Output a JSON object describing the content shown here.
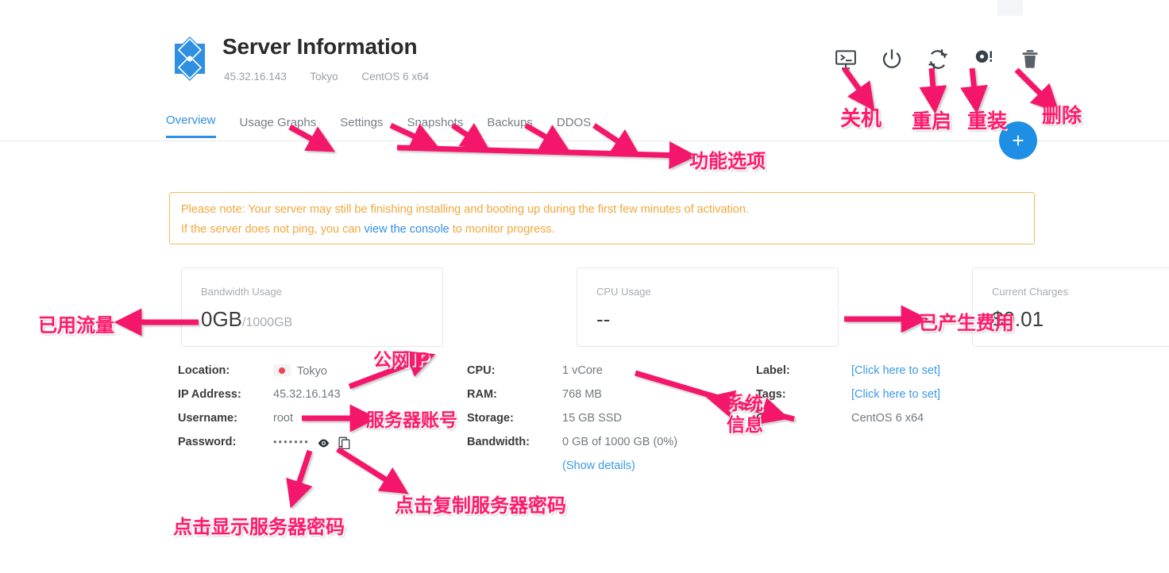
{
  "header": {
    "logo_icon": "vultr-diamond-logo",
    "title": "Server Information",
    "ip": "45.32.16.143",
    "location": "Tokyo",
    "os": "CentOS 6 x64"
  },
  "tabs": [
    {
      "label": "Overview",
      "active": true
    },
    {
      "label": "Usage Graphs",
      "active": false
    },
    {
      "label": "Settings",
      "active": false
    },
    {
      "label": "Snapshots",
      "active": false
    },
    {
      "label": "Backups",
      "active": false
    },
    {
      "label": "DDOS",
      "active": false
    }
  ],
  "actions": [
    {
      "name": "console-icon",
      "title": "View Console"
    },
    {
      "name": "power-icon",
      "title": "Power"
    },
    {
      "name": "restart-icon",
      "title": "Restart"
    },
    {
      "name": "reinstall-icon",
      "title": "Reinstall"
    },
    {
      "name": "delete-icon",
      "title": "Destroy"
    }
  ],
  "fab": {
    "label": "+",
    "icon": "plus-icon"
  },
  "notice": {
    "line1": "Please note: Your server may still be finishing installing and booting up during the first few minutes of activation.",
    "line2_before": "If the server does not ping, you can ",
    "link": "view the console",
    "line2_after": " to monitor progress."
  },
  "cards": [
    {
      "label": "Bandwidth Usage",
      "value": "0GB",
      "suffix": "/1000GB"
    },
    {
      "label": "CPU Usage",
      "value": "--",
      "suffix": ""
    },
    {
      "label": "Current Charges",
      "value": "$0.01",
      "suffix": ""
    }
  ],
  "details": {
    "col1": [
      {
        "key": "Location:",
        "value": "Tokyo",
        "type": "flag"
      },
      {
        "key": "IP Address:",
        "value": "45.32.16.143",
        "type": "text"
      },
      {
        "key": "Username:",
        "value": "root",
        "type": "text"
      },
      {
        "key": "Password:",
        "value": "•••••••",
        "type": "password"
      }
    ],
    "col2": [
      {
        "key": "CPU:",
        "value": "1 vCore",
        "type": "text"
      },
      {
        "key": "RAM:",
        "value": "768 MB",
        "type": "text"
      },
      {
        "key": "Storage:",
        "value": "15 GB SSD",
        "type": "text"
      },
      {
        "key": "Bandwidth:",
        "value": "0 GB of 1000 GB (0%)",
        "type": "text"
      },
      {
        "key": "",
        "value": "(Show details)",
        "type": "link"
      }
    ],
    "col3": [
      {
        "key": "Label:",
        "value": "[Click here to set]",
        "type": "link"
      },
      {
        "key": "Tags:",
        "value": "[Click here to set]",
        "type": "link"
      },
      {
        "key": "OS:",
        "value": "CentOS 6 x64",
        "type": "text"
      }
    ]
  },
  "annotations": [
    {
      "name": "annotation-shutdown",
      "text": "关机"
    },
    {
      "name": "annotation-restart",
      "text": "重启"
    },
    {
      "name": "annotation-reinstall",
      "text": "重装"
    },
    {
      "name": "annotation-delete",
      "text": "删除"
    },
    {
      "name": "annotation-feature-tabs",
      "text": "功能选项"
    },
    {
      "name": "annotation-used-bandwidth",
      "text": "已用流量"
    },
    {
      "name": "annotation-current-charges",
      "text": "已产生费用"
    },
    {
      "name": "annotation-public-ip",
      "text": "公网IP"
    },
    {
      "name": "annotation-server-account",
      "text": "服务器账号"
    },
    {
      "name": "annotation-system-info-1",
      "text": "系统"
    },
    {
      "name": "annotation-system-info-2",
      "text": "信息"
    },
    {
      "name": "annotation-show-password",
      "text": "点击显示服务器密码"
    },
    {
      "name": "annotation-copy-password",
      "text": "点击复制服务器密码"
    }
  ],
  "colors": {
    "accent_blue": "#2f8fe0",
    "annotation_pink": "#ff1a6b",
    "notice_orange": "#f2a73c"
  }
}
